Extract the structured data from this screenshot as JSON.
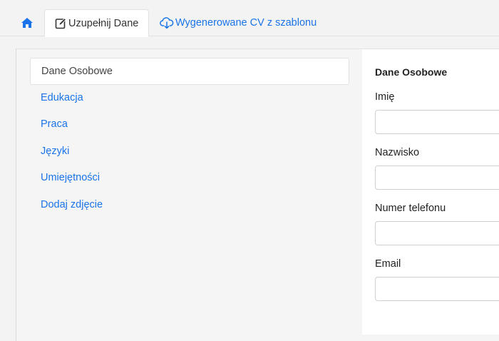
{
  "tabs": {
    "home": {
      "icon": "home-icon"
    },
    "fill": {
      "label": "Uzupełnij Dane",
      "icon": "edit-icon"
    },
    "generated": {
      "label": "Wygenerowane CV z szablonu",
      "icon": "cloud-download-icon"
    }
  },
  "sidebar": {
    "items": [
      {
        "label": "Dane Osobowe",
        "active": true
      },
      {
        "label": "Edukacja"
      },
      {
        "label": "Praca"
      },
      {
        "label": "Języki"
      },
      {
        "label": "Umiejętności"
      },
      {
        "label": "Dodaj zdjęcie"
      }
    ]
  },
  "form": {
    "title": "Dane Osobowe",
    "fields": [
      {
        "label": "Imię",
        "value": ""
      },
      {
        "label": "Nazwisko",
        "value": ""
      },
      {
        "label": "Numer telefonu",
        "value": ""
      },
      {
        "label": "Email",
        "value": ""
      }
    ]
  },
  "colors": {
    "link": "#1a73e8",
    "background": "#f3f3f3",
    "panel": "#f5f5f5"
  }
}
